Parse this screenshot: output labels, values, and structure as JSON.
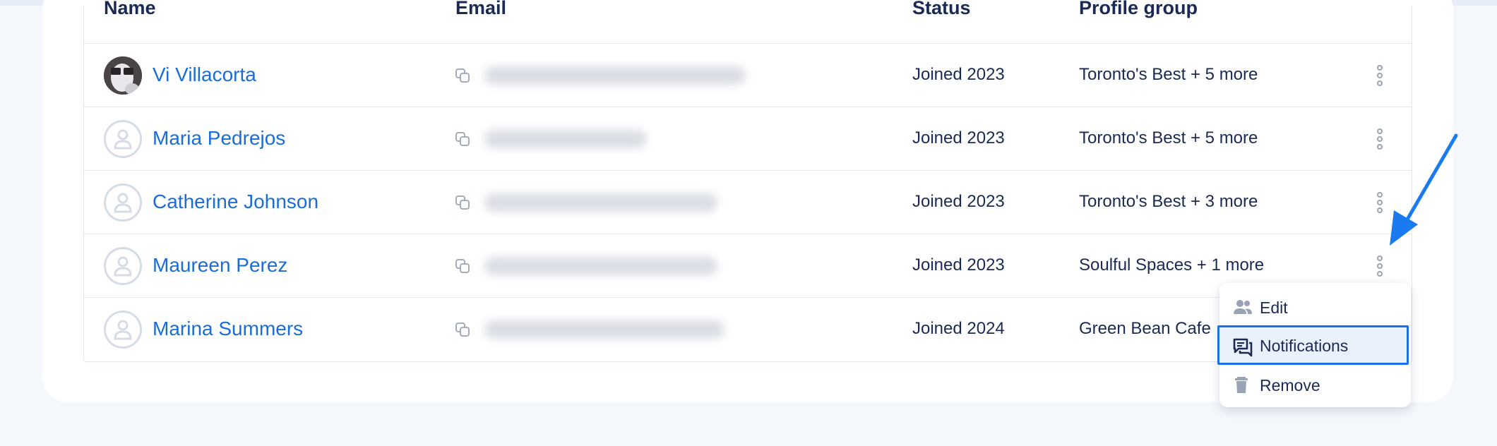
{
  "table": {
    "headers": {
      "name": "Name",
      "email": "Email",
      "status": "Status",
      "profile_group": "Profile group"
    },
    "rows": [
      {
        "name": "Vi Villacorta",
        "status": "Joined 2023",
        "profile_group": "Toronto's Best + 5 more",
        "avatar": "photo"
      },
      {
        "name": "Maria Pedrejos",
        "status": "Joined 2023",
        "profile_group": "Toronto's Best + 5 more",
        "avatar": "placeholder"
      },
      {
        "name": "Catherine Johnson",
        "status": "Joined 2023",
        "profile_group": "Toronto's Best + 3 more",
        "avatar": "placeholder"
      },
      {
        "name": "Maureen Perez",
        "status": "Joined 2023",
        "profile_group": "Soulful Spaces + 1 more",
        "avatar": "placeholder"
      },
      {
        "name": "Marina Summers",
        "status": "Joined 2024",
        "profile_group": "Green Bean Cafe",
        "avatar": "placeholder"
      }
    ]
  },
  "context_menu": {
    "items": [
      {
        "label": "Edit",
        "icon": "people-icon"
      },
      {
        "label": "Notifications",
        "icon": "chat-bubbles-icon",
        "highlighted": true
      },
      {
        "label": "Remove",
        "icon": "trash-icon"
      }
    ]
  },
  "colors": {
    "link": "#1a6cd8",
    "text": "#1b2a55",
    "highlight_border": "#1a72e8",
    "annotation_arrow": "#1a7bf0"
  }
}
